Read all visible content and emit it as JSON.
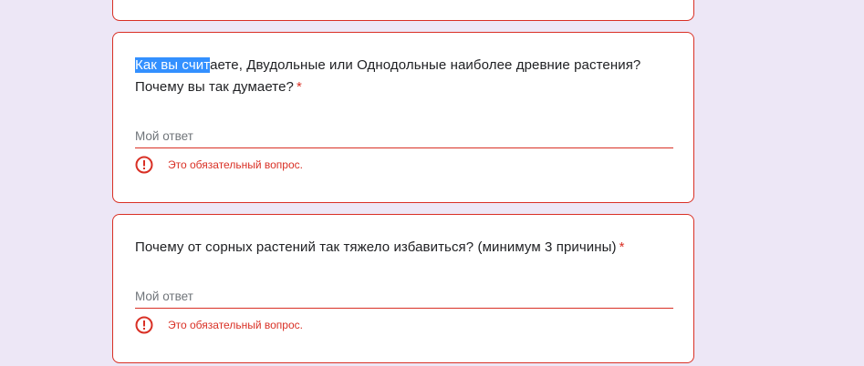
{
  "colors": {
    "background": "#ede7f6",
    "card": "#ffffff",
    "error": "#d93025",
    "selection": "#3390ff"
  },
  "questions": [
    {
      "text_selected": "Как вы счит",
      "text_rest": "аете, Двудольные или Однодольные наиболее древние растения? Почему вы так думаете?",
      "required_mark": "*",
      "answer_placeholder": "Мой ответ",
      "error_text": "Это обязательный вопрос.",
      "error_icon": "alert-circle-icon"
    },
    {
      "text_selected": "",
      "text_rest": "Почему от сорных растений так тяжело избавиться? (минимум 3 причины)",
      "required_mark": "*",
      "answer_placeholder": "Мой ответ",
      "error_text": "Это обязательный вопрос.",
      "error_icon": "alert-circle-icon"
    }
  ]
}
